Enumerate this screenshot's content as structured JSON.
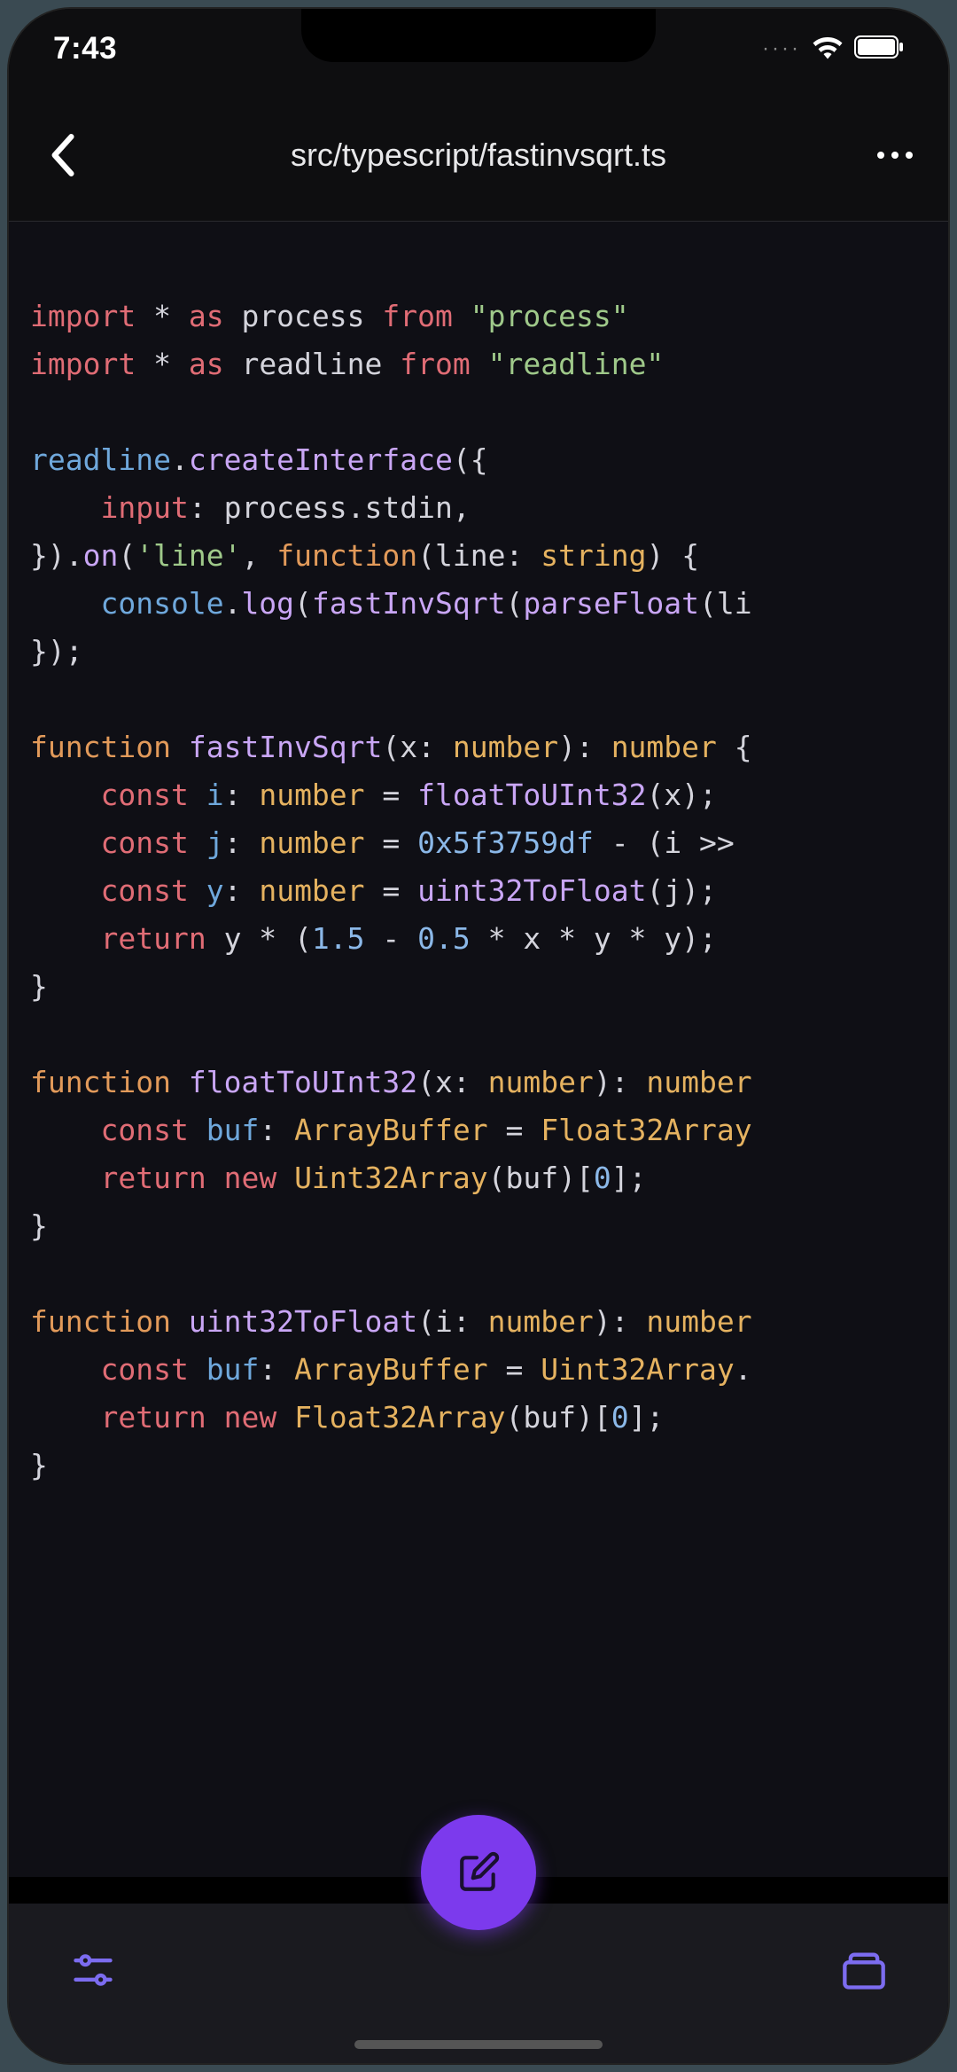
{
  "status": {
    "time": "7:43",
    "signal_dots": "····"
  },
  "header": {
    "title": "src/typescript/fastinvsqrt.ts"
  },
  "code": {
    "lines": [
      [
        {
          "t": "kw",
          "v": "import"
        },
        {
          "t": "punc",
          "v": " * "
        },
        {
          "t": "kw",
          "v": "as"
        },
        {
          "t": "id",
          "v": " process "
        },
        {
          "t": "kw",
          "v": "from"
        },
        {
          "t": "punc",
          "v": " "
        },
        {
          "t": "str",
          "v": "\"process\""
        }
      ],
      [
        {
          "t": "kw",
          "v": "import"
        },
        {
          "t": "punc",
          "v": " * "
        },
        {
          "t": "kw",
          "v": "as"
        },
        {
          "t": "id",
          "v": " readline "
        },
        {
          "t": "kw",
          "v": "from"
        },
        {
          "t": "punc",
          "v": " "
        },
        {
          "t": "str",
          "v": "\"readline\""
        }
      ],
      [],
      [
        {
          "t": "blue",
          "v": "readline"
        },
        {
          "t": "punc",
          "v": "."
        },
        {
          "t": "fn",
          "v": "createInterface"
        },
        {
          "t": "punc",
          "v": "({"
        }
      ],
      [
        {
          "t": "punc",
          "v": "    "
        },
        {
          "t": "prop",
          "v": "input"
        },
        {
          "t": "punc",
          "v": ": process.stdin,"
        }
      ],
      [
        {
          "t": "punc",
          "v": "})."
        },
        {
          "t": "fn",
          "v": "on"
        },
        {
          "t": "punc",
          "v": "("
        },
        {
          "t": "str",
          "v": "'line'"
        },
        {
          "t": "punc",
          "v": ", "
        },
        {
          "t": "kw2",
          "v": "function"
        },
        {
          "t": "punc",
          "v": "(line: "
        },
        {
          "t": "type",
          "v": "string"
        },
        {
          "t": "punc",
          "v": ") {"
        }
      ],
      [
        {
          "t": "punc",
          "v": "    "
        },
        {
          "t": "blue",
          "v": "console"
        },
        {
          "t": "punc",
          "v": "."
        },
        {
          "t": "fn",
          "v": "log"
        },
        {
          "t": "punc",
          "v": "("
        },
        {
          "t": "fn",
          "v": "fastInvSqrt"
        },
        {
          "t": "punc",
          "v": "("
        },
        {
          "t": "fn",
          "v": "parseFloat"
        },
        {
          "t": "punc",
          "v": "(li"
        }
      ],
      [
        {
          "t": "punc",
          "v": "});"
        }
      ],
      [],
      [
        {
          "t": "kw2",
          "v": "function"
        },
        {
          "t": "punc",
          "v": " "
        },
        {
          "t": "fn",
          "v": "fastInvSqrt"
        },
        {
          "t": "punc",
          "v": "(x: "
        },
        {
          "t": "type",
          "v": "number"
        },
        {
          "t": "punc",
          "v": "): "
        },
        {
          "t": "type",
          "v": "number"
        },
        {
          "t": "punc",
          "v": " {"
        }
      ],
      [
        {
          "t": "punc",
          "v": "    "
        },
        {
          "t": "kw",
          "v": "const"
        },
        {
          "t": "punc",
          "v": " "
        },
        {
          "t": "blue",
          "v": "i"
        },
        {
          "t": "punc",
          "v": ": "
        },
        {
          "t": "type",
          "v": "number"
        },
        {
          "t": "punc",
          "v": " = "
        },
        {
          "t": "fn",
          "v": "floatToUInt32"
        },
        {
          "t": "punc",
          "v": "(x);"
        }
      ],
      [
        {
          "t": "punc",
          "v": "    "
        },
        {
          "t": "kw",
          "v": "const"
        },
        {
          "t": "punc",
          "v": " "
        },
        {
          "t": "blue",
          "v": "j"
        },
        {
          "t": "punc",
          "v": ": "
        },
        {
          "t": "type",
          "v": "number"
        },
        {
          "t": "punc",
          "v": " = "
        },
        {
          "t": "num",
          "v": "0x5f3759df"
        },
        {
          "t": "punc",
          "v": " - (i >> "
        }
      ],
      [
        {
          "t": "punc",
          "v": "    "
        },
        {
          "t": "kw",
          "v": "const"
        },
        {
          "t": "punc",
          "v": " "
        },
        {
          "t": "blue",
          "v": "y"
        },
        {
          "t": "punc",
          "v": ": "
        },
        {
          "t": "type",
          "v": "number"
        },
        {
          "t": "punc",
          "v": " = "
        },
        {
          "t": "fn",
          "v": "uint32ToFloat"
        },
        {
          "t": "punc",
          "v": "(j);"
        }
      ],
      [
        {
          "t": "punc",
          "v": "    "
        },
        {
          "t": "kw",
          "v": "return"
        },
        {
          "t": "punc",
          "v": " y * ("
        },
        {
          "t": "num",
          "v": "1.5"
        },
        {
          "t": "punc",
          "v": " - "
        },
        {
          "t": "num",
          "v": "0.5"
        },
        {
          "t": "punc",
          "v": " * x * y * y);"
        }
      ],
      [
        {
          "t": "punc",
          "v": "}"
        }
      ],
      [],
      [
        {
          "t": "kw2",
          "v": "function"
        },
        {
          "t": "punc",
          "v": " "
        },
        {
          "t": "fn",
          "v": "floatToUInt32"
        },
        {
          "t": "punc",
          "v": "(x: "
        },
        {
          "t": "type",
          "v": "number"
        },
        {
          "t": "punc",
          "v": "): "
        },
        {
          "t": "type",
          "v": "number"
        }
      ],
      [
        {
          "t": "punc",
          "v": "    "
        },
        {
          "t": "kw",
          "v": "const"
        },
        {
          "t": "punc",
          "v": " "
        },
        {
          "t": "blue",
          "v": "buf"
        },
        {
          "t": "punc",
          "v": ": "
        },
        {
          "t": "type",
          "v": "ArrayBuffer"
        },
        {
          "t": "punc",
          "v": " = "
        },
        {
          "t": "type",
          "v": "Float32Array"
        }
      ],
      [
        {
          "t": "punc",
          "v": "    "
        },
        {
          "t": "kw",
          "v": "return"
        },
        {
          "t": "punc",
          "v": " "
        },
        {
          "t": "kw",
          "v": "new"
        },
        {
          "t": "punc",
          "v": " "
        },
        {
          "t": "type",
          "v": "Uint32Array"
        },
        {
          "t": "punc",
          "v": "(buf)["
        },
        {
          "t": "num",
          "v": "0"
        },
        {
          "t": "punc",
          "v": "];"
        }
      ],
      [
        {
          "t": "punc",
          "v": "}"
        }
      ],
      [],
      [
        {
          "t": "kw2",
          "v": "function"
        },
        {
          "t": "punc",
          "v": " "
        },
        {
          "t": "fn",
          "v": "uint32ToFloat"
        },
        {
          "t": "punc",
          "v": "(i: "
        },
        {
          "t": "type",
          "v": "number"
        },
        {
          "t": "punc",
          "v": "): "
        },
        {
          "t": "type",
          "v": "number"
        }
      ],
      [
        {
          "t": "punc",
          "v": "    "
        },
        {
          "t": "kw",
          "v": "const"
        },
        {
          "t": "punc",
          "v": " "
        },
        {
          "t": "blue",
          "v": "buf"
        },
        {
          "t": "punc",
          "v": ": "
        },
        {
          "t": "type",
          "v": "ArrayBuffer"
        },
        {
          "t": "punc",
          "v": " = "
        },
        {
          "t": "type",
          "v": "Uint32Array"
        },
        {
          "t": "punc",
          "v": "."
        }
      ],
      [
        {
          "t": "punc",
          "v": "    "
        },
        {
          "t": "kw",
          "v": "return"
        },
        {
          "t": "punc",
          "v": " "
        },
        {
          "t": "kw",
          "v": "new"
        },
        {
          "t": "punc",
          "v": " "
        },
        {
          "t": "type",
          "v": "Float32Array"
        },
        {
          "t": "punc",
          "v": "(buf)["
        },
        {
          "t": "num",
          "v": "0"
        },
        {
          "t": "punc",
          "v": "];"
        }
      ],
      [
        {
          "t": "punc",
          "v": "}"
        }
      ]
    ]
  },
  "colors": {
    "accent": "#7c3aed",
    "bg": "#0f0f15"
  }
}
